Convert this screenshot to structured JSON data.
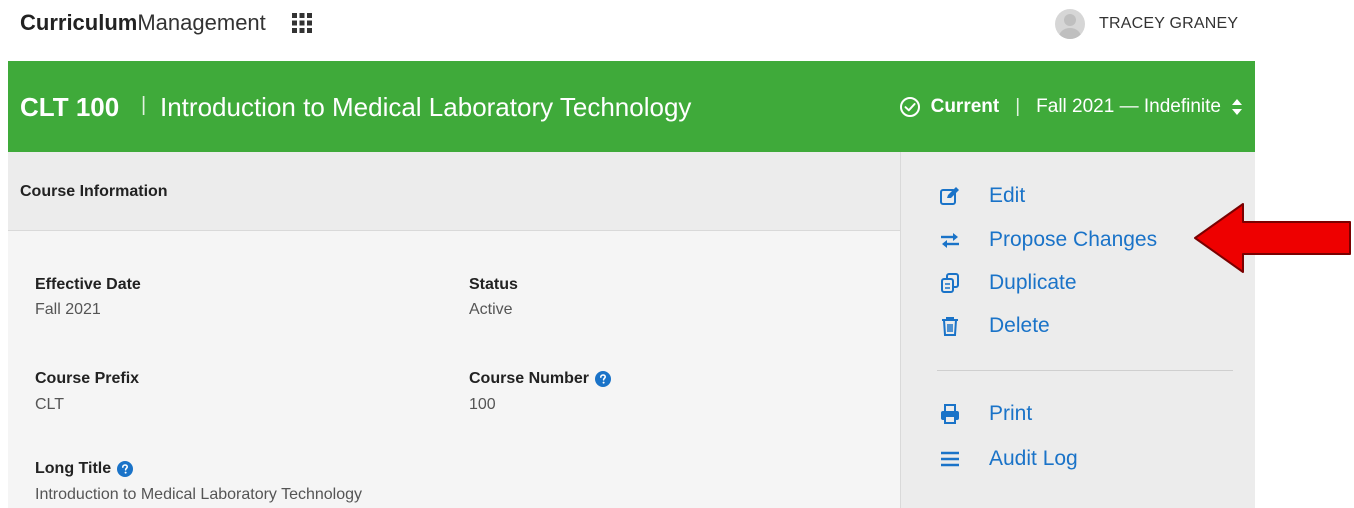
{
  "header": {
    "brand_bold": "Curriculum",
    "brand_light": "Management",
    "user_name": "TRACEY GRANEY"
  },
  "course": {
    "code": "CLT 100",
    "separator": "|",
    "title": "Introduction to Medical Laboratory Technology",
    "status": "Current",
    "term": "Fall 2021 — Indefinite"
  },
  "section": {
    "title": "Course Information",
    "fields": [
      {
        "label": "Effective Date",
        "value": "Fall 2021",
        "help": false
      },
      {
        "label": "Status",
        "value": "Active",
        "help": false
      },
      {
        "label": "Course Prefix",
        "value": "CLT",
        "help": false
      },
      {
        "label": "Course Number",
        "value": "100",
        "help": true
      },
      {
        "label": "Long Title",
        "value": "Introduction to Medical Laboratory Technology",
        "help": true
      }
    ]
  },
  "actions": [
    {
      "label": "Edit",
      "icon": "edit-icon"
    },
    {
      "label": "Propose Changes",
      "icon": "swap-arrows-icon"
    },
    {
      "label": "Duplicate",
      "icon": "duplicate-icon"
    },
    {
      "label": "Delete",
      "icon": "trash-icon"
    },
    {
      "label": "Print",
      "icon": "print-icon"
    },
    {
      "label": "Audit Log",
      "icon": "list-icon"
    }
  ],
  "colors": {
    "accent_green": "#3faa3a",
    "link_blue": "#1a73c8",
    "annotation_red": "#ee0000"
  }
}
